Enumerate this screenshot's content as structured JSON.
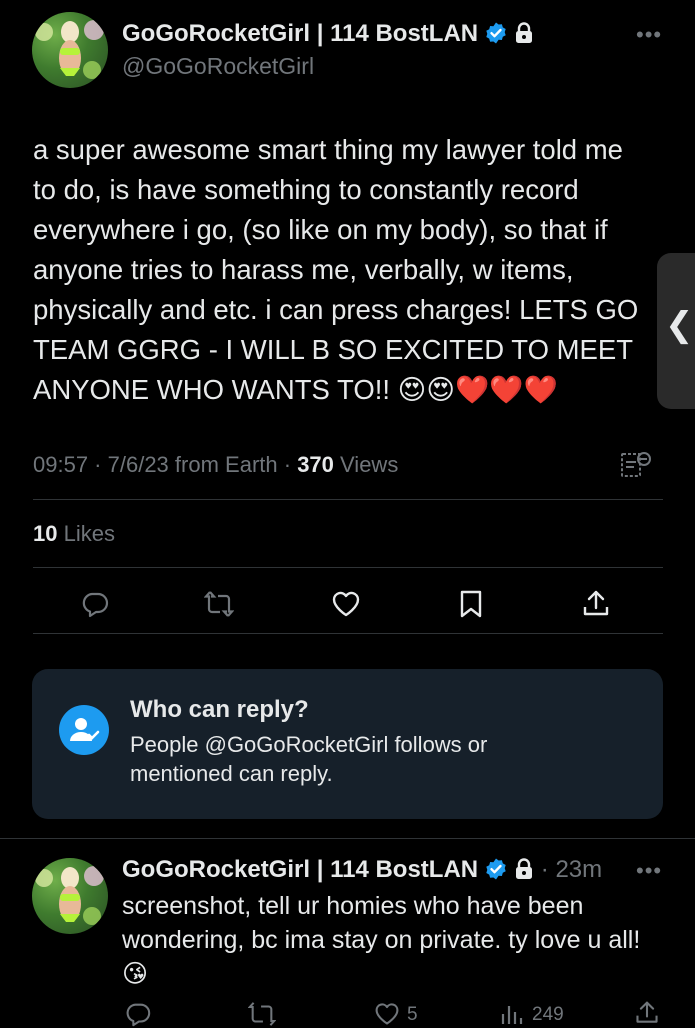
{
  "main_tweet": {
    "display_name": "GoGoRocketGirl | 114 BostLAN",
    "handle": "@GoGoRocketGirl",
    "lines": [
      "a super awesome smart thing my lawyer told me",
      "to do, is have something to constantly record",
      "everywhere i go, (so like on my body), so that if",
      "anyone tries to harass me, verbally, w items,",
      "physically and etc. i can press charges! LETS GO",
      "TEAM GGRG - I WILL B SO EXCITED TO MEET",
      "ANYONE WHO WANTS TO!!"
    ],
    "emojis": [
      "😍",
      "😍",
      "❤️",
      "❤️",
      "❤️"
    ],
    "time": "09:57",
    "date": "7/6/23",
    "source": "from Earth",
    "views_count": "370",
    "views_label": "Views",
    "likes_count": "10",
    "likes_label": "Likes",
    "icons": {
      "verified": "verified-badge-icon",
      "lock": "lock-icon",
      "more": "more-icon",
      "analytics": "analytics-icon",
      "reply": "reply-icon",
      "retweet": "retweet-icon",
      "like": "heart-icon",
      "bookmark": "bookmark-icon",
      "share": "share-icon"
    }
  },
  "reply_restriction": {
    "title": "Who can reply?",
    "line1": "People @GoGoRocketGirl follows or",
    "line2": "mentioned can reply."
  },
  "reply_tweet": {
    "display_name": "GoGoRocketGirl | 114 BostLAN",
    "time_ago": "23m",
    "line1": "screenshot, tell ur homies who have been",
    "line2": "wondering, bc ima stay on private. ty love u all!",
    "emoji": "😘",
    "likes": "5",
    "views": "249"
  },
  "colors": {
    "background": "#000000",
    "text": "#e7e9ea",
    "muted": "#71767b",
    "accent": "#1d9bf0",
    "card": "#16202a",
    "heart": "#f5253b"
  },
  "side_tab": {
    "glyph": "❮"
  }
}
